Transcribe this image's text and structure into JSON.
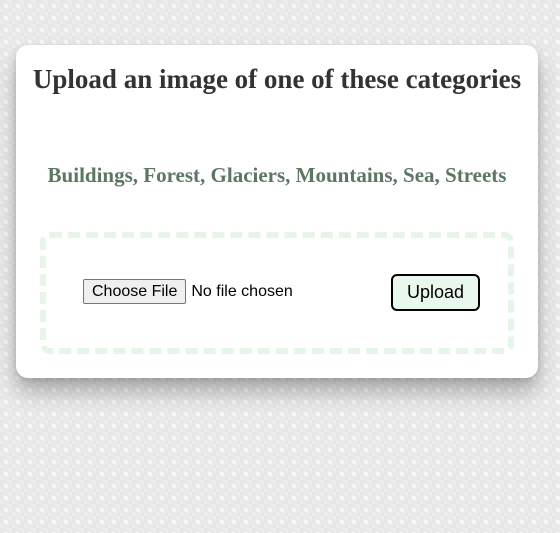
{
  "upload_card": {
    "title": "Upload an image of one of these categories",
    "categories_text": "Buildings, Forest, Glaciers, Mountains, Sea, Streets",
    "file_input": {
      "button_label": "Choose File",
      "status": "No file chosen"
    },
    "upload_button_label": "Upload"
  },
  "colors": {
    "page_background": "#e6e6e6",
    "card_background": "#ffffff",
    "title_text": "#333333",
    "categories_text": "#5b7764",
    "drop_zone_border": "#e5f5e8",
    "upload_button_background": "#e9f8ec"
  }
}
